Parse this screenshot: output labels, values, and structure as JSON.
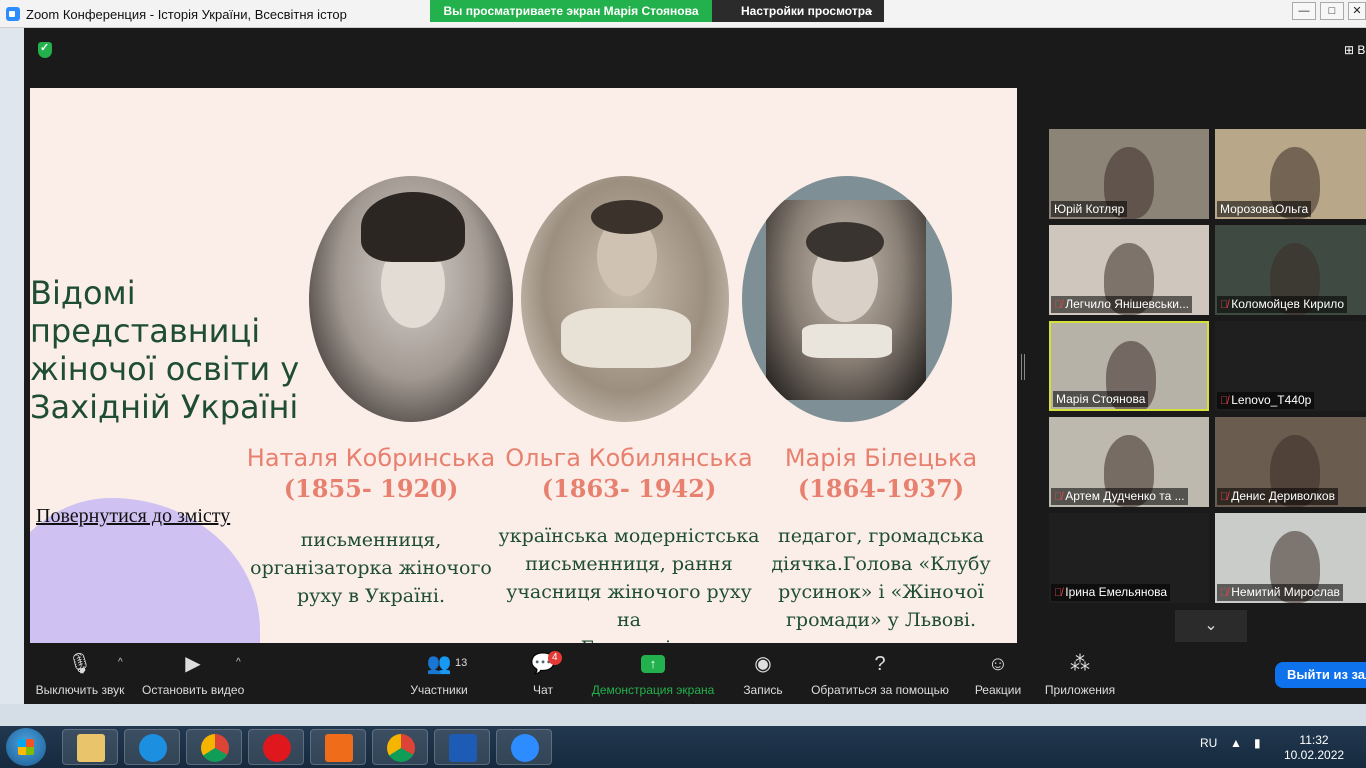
{
  "window": {
    "title": "Zoom Конференция - Історія України, Всесвітня істор",
    "share_banner": "Вы просматриваете экран Марія Стоянова",
    "view_settings": "Настройки просмотра",
    "minimize": "—",
    "restore": "□",
    "grid_view_label": "В"
  },
  "slide": {
    "heading_lines": [
      "Відомі",
      "представниці",
      "жіночої освіти у",
      "Західній Україні"
    ],
    "back_link": "Повернутися до змісту",
    "persons": [
      {
        "name": "Наталя Кобринська",
        "years": "(1855- 1920)",
        "desc_lines": [
          "письменниця,",
          "організаторка жіночого",
          "руху в Україні."
        ]
      },
      {
        "name": "Ольга Кобилянська",
        "years": "(1863- 1942)",
        "desc_lines": [
          "українська модерністська",
          "письменниця, рання",
          "учасниця жіночого руху на",
          "Буковині."
        ]
      },
      {
        "name": "Марія Білецька",
        "years": "(1864-1937)",
        "desc_lines": [
          "педагог, громадська",
          "діячка.Голова «Клубу",
          "русинок» і «Жіночої",
          "громади» у Львові."
        ]
      }
    ]
  },
  "participants": [
    {
      "name": "Юрій Котляр",
      "muted": false,
      "active": false,
      "bg": "#8d8478"
    },
    {
      "name": "МорозоваОльга",
      "muted": false,
      "active": false,
      "bg": "#b9a78a"
    },
    {
      "name": "Легчило Янішевськи...",
      "muted": true,
      "active": false,
      "bg": "#cfc7bd"
    },
    {
      "name": "Коломойцев Кирило",
      "muted": true,
      "active": false,
      "bg": "#3f4a42"
    },
    {
      "name": "Марія Стоянова",
      "muted": false,
      "active": true,
      "bg": "#b7b2a8"
    },
    {
      "name": "Lenovo_T440p",
      "muted": true,
      "active": false,
      "bg": "#1f1f1f"
    },
    {
      "name": "Артем Дудченко та ...",
      "muted": true,
      "active": false,
      "bg": "#bdb9ae"
    },
    {
      "name": "Денис Дериволков",
      "muted": true,
      "active": false,
      "bg": "#6a5c4e"
    },
    {
      "name": "Ірина Емельянова",
      "muted": true,
      "active": false,
      "bg": "#1f1f1f"
    },
    {
      "name": "Немитий Мирослав",
      "muted": true,
      "active": false,
      "bg": "#c9ccc8"
    }
  ],
  "scroll_down": "⌄",
  "toolbar": {
    "mute": "Выключить звук",
    "stop_video": "Остановить видео",
    "participants": "Участники",
    "participants_count": "13",
    "chat": "Чат",
    "chat_badge": "4",
    "share": "Демонстрация экрана",
    "record": "Запись",
    "help": "Обратиться за помощью",
    "reactions": "Реакции",
    "apps": "Приложения",
    "leave": "Выйти из зала"
  },
  "taskbar": {
    "lang": "RU",
    "time": "11:32",
    "date": "10.02.2022"
  }
}
